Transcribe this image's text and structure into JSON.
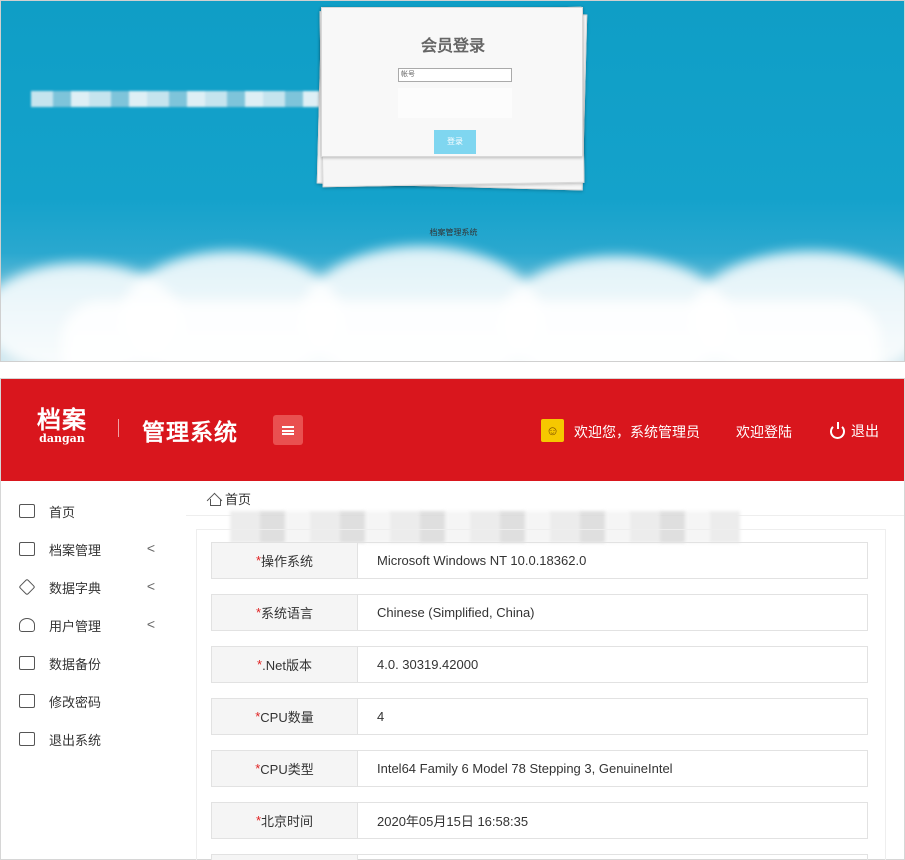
{
  "login": {
    "title": "会员登录",
    "account_placeholder": "帐号",
    "button_label": "登录",
    "footer": "档案管理系统"
  },
  "header": {
    "logo_main": "档案",
    "logo_sub": "dangan",
    "system_title": "管理系统",
    "welcome_user": "欢迎您，系统管理员",
    "welcome_login": "欢迎登陆",
    "logout": "退出"
  },
  "sidebar": {
    "items": [
      {
        "label": "首页",
        "icon": "dashboard-icon",
        "has_submenu": false
      },
      {
        "label": "档案管理",
        "icon": "archive-icon",
        "has_submenu": true
      },
      {
        "label": "数据字典",
        "icon": "tag-icon",
        "has_submenu": true
      },
      {
        "label": "用户管理",
        "icon": "user-icon",
        "has_submenu": true
      },
      {
        "label": "数据备份",
        "icon": "backup-icon",
        "has_submenu": false
      },
      {
        "label": "修改密码",
        "icon": "password-icon",
        "has_submenu": false
      },
      {
        "label": "退出系统",
        "icon": "exit-icon",
        "has_submenu": false
      }
    ],
    "chevron": "<"
  },
  "breadcrumb": {
    "home": "首页"
  },
  "info": {
    "required_mark": "*",
    "rows": [
      {
        "label": "操作系统",
        "value": "Microsoft Windows NT 10.0.18362.0"
      },
      {
        "label": "系统语言",
        "value": "Chinese (Simplified, China)"
      },
      {
        "label": ".Net版本",
        "value": "4.0. 30319.42000"
      },
      {
        "label": "CPU数量",
        "value": "4"
      },
      {
        "label": "CPU类型",
        "value": "Intel64 Family 6 Model 78 Stepping 3, GenuineIntel"
      },
      {
        "label": "北京时间",
        "value": "2020年05月15日 16:58:35"
      }
    ]
  },
  "colors": {
    "header_red": "#d9161d",
    "login_blue": "#14a2cb",
    "required_red": "#e02020"
  }
}
